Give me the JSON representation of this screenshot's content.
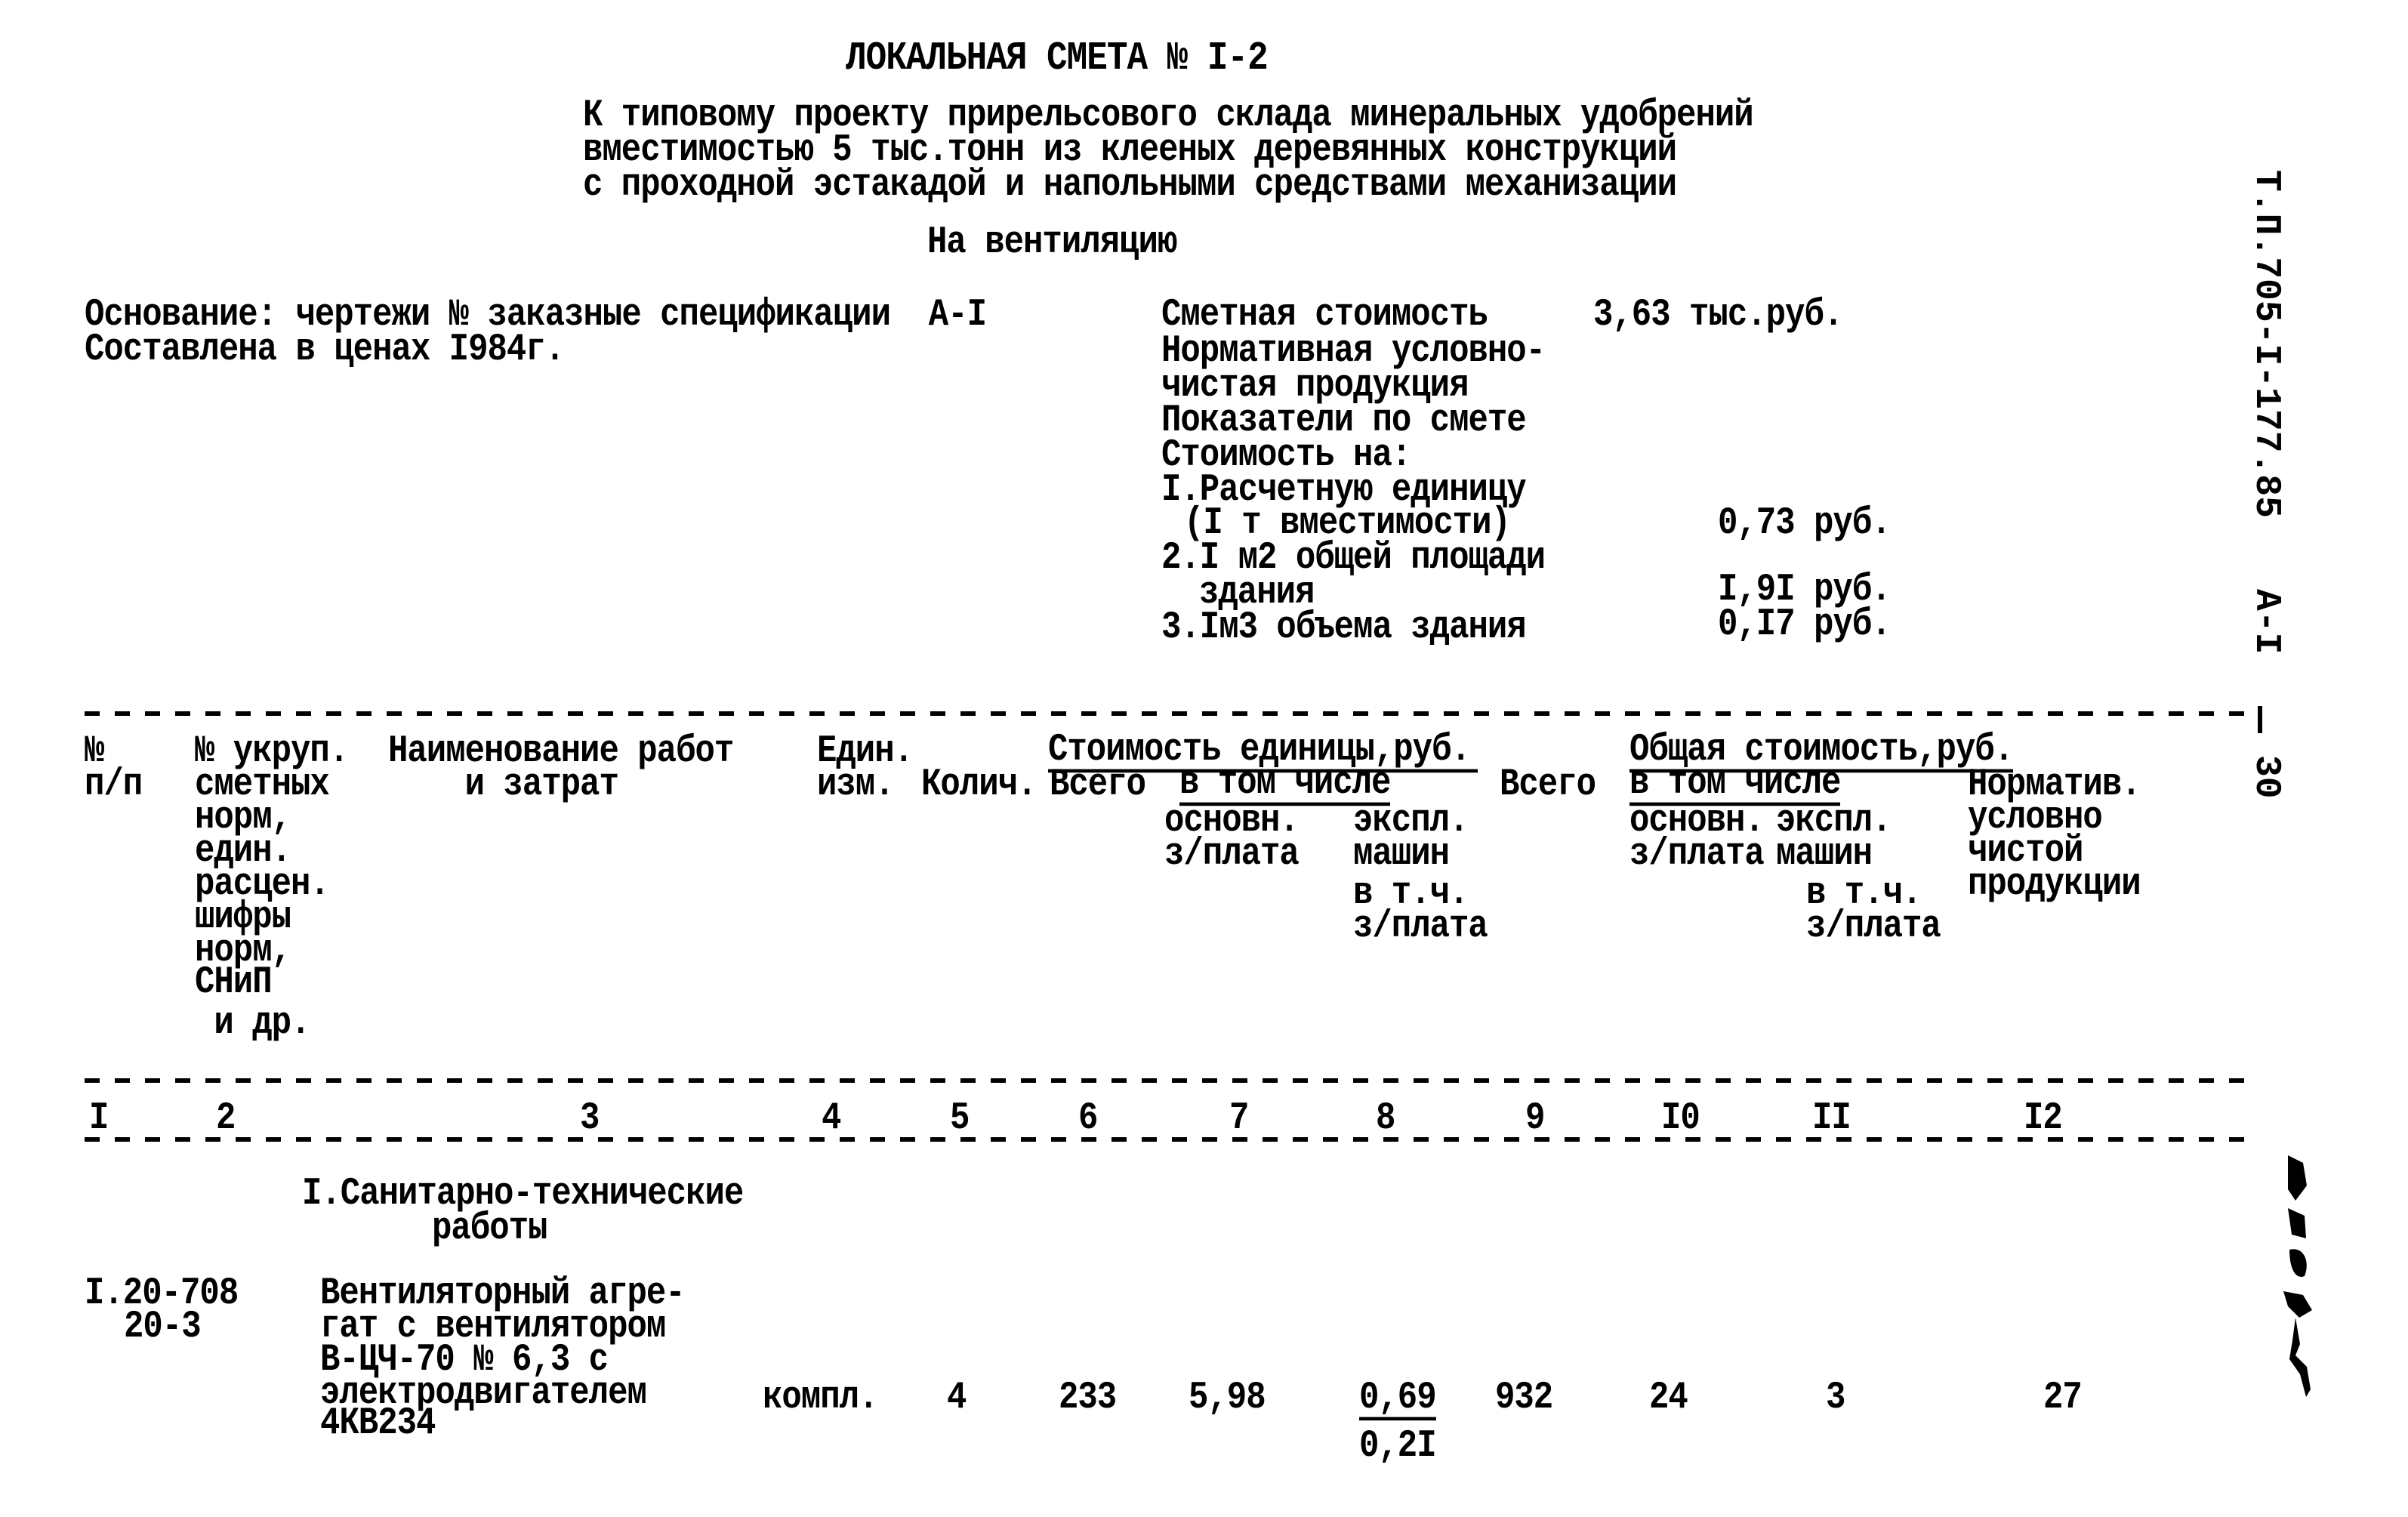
{
  "header": {
    "title": "ЛОКАЛЬНАЯ СМЕТА № I-2",
    "subtitle_lines": [
      "К типовому проекту прирельсового склада минеральных удобрений",
      "вместимостью 5 тыс.тонн из клееных деревянных конструкций",
      "с проходной эстакадой и напольными средствами механизации"
    ],
    "purpose": "На вентиляцию"
  },
  "side_label": {
    "project_code": "Т.П.705-I-177.85",
    "album": "А-I",
    "page": "30"
  },
  "basis": {
    "line1": "Основание: чертежи № заказные спецификации  А-I",
    "line2": "Составлена в ценах I984г."
  },
  "summary": {
    "estimated_cost_label": "Сметная стоимость",
    "estimated_cost_value": "3,63 тыс.руб.",
    "normative_label_1": "Нормативная условно-",
    "normative_label_2": "чистая продукция",
    "indicators_label": "Показатели по смете",
    "cost_per_label": "Стоимость на:",
    "item1_line1": "I.Расчетную единицу",
    "item1_line2": "(I т вместимости)",
    "item1_value": "0,73 руб.",
    "item2_line1": "2.I м2 общей площади",
    "item2_line2": "здания",
    "item2_value": "I,9I руб.",
    "item3_line1": "3.Iм3 объема здания",
    "item3_value": "0,I7 руб."
  },
  "table": {
    "headers": {
      "c1": [
        "№",
        "п/п"
      ],
      "c2": [
        "№ укруп.",
        "сметных",
        "норм,",
        "един.",
        "расцен.",
        "шифры",
        "норм,",
        "СНиП",
        " и др."
      ],
      "c3": [
        "Наименование работ",
        "    и затрат"
      ],
      "c4": [
        "Един.",
        "изм."
      ],
      "c5": "Колич.",
      "unit_cost_group": "Стоимость единицы,руб.",
      "c6": "Всего",
      "in_that_number_1": "в том числе",
      "c7": [
        "основн.",
        "з/плата"
      ],
      "c8": [
        "экспл.",
        "машин",
        "в т.ч.",
        "з/плата"
      ],
      "total_cost_group": "Общая стоимость,руб.",
      "c9": "Всего",
      "in_that_number_2": "в том числе",
      "c10": [
        "основн.",
        "з/плата"
      ],
      "c11": [
        "экспл.",
        "машин",
        "в т.ч.",
        "з/плата"
      ],
      "c12": [
        "Норматив.",
        "условно",
        "чистой",
        "продукции"
      ]
    },
    "column_numbers": [
      "I",
      "2",
      "3",
      "4",
      "5",
      "6",
      "7",
      "8",
      "9",
      "I0",
      "II",
      "I2"
    ],
    "section": {
      "line1": "I.Санитарно-технические",
      "line2": "работы"
    },
    "rows": [
      {
        "code_line1": "I.20-708",
        "code_line2": "20-3",
        "name_lines": [
          "Вентиляторный агре-",
          "гат с вентилятором",
          "В-ЦЧ-70 № 6,3 с",
          "электродвигателем",
          "4КВ234"
        ],
        "unit": "компл.",
        "qty": "4",
        "unit_total": "233",
        "unit_wage": "5,98",
        "unit_machines": "0,69",
        "unit_machines_wage": "0,2I",
        "total": "932",
        "total_wage": "24",
        "total_machines": "3",
        "normative": "27"
      }
    ]
  }
}
